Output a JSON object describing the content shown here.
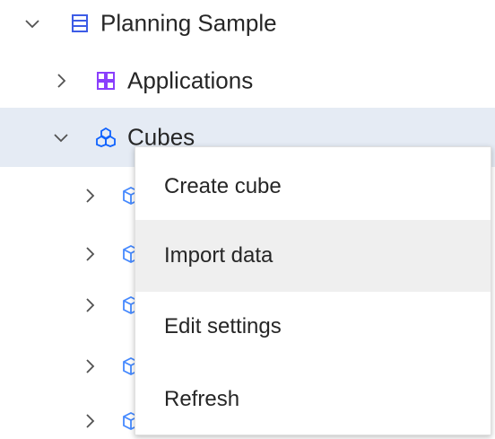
{
  "tree": {
    "root": {
      "label": "Planning Sample",
      "expanded": true,
      "icon": "database-icon"
    },
    "applications": {
      "label": "Applications",
      "expanded": false,
      "icon": "applications-icon"
    },
    "cubes": {
      "label": "Cubes",
      "expanded": true,
      "selected": true,
      "icon": "cubes-icon"
    },
    "cube_children_count_visible": 5
  },
  "context_menu": {
    "items": [
      {
        "label": "Create cube"
      },
      {
        "label": "Import data",
        "hovered": true
      },
      {
        "label": "Edit settings"
      },
      {
        "label": "Refresh"
      }
    ]
  },
  "colors": {
    "selected_row_bg": "#e5ebf4",
    "menu_hover_bg": "#efefef",
    "root_icon": "#3d5ce6",
    "applications_icon": "#8a3ffc",
    "cubes_icon": "#0f62fe",
    "cube_icon": "#4589ff"
  }
}
